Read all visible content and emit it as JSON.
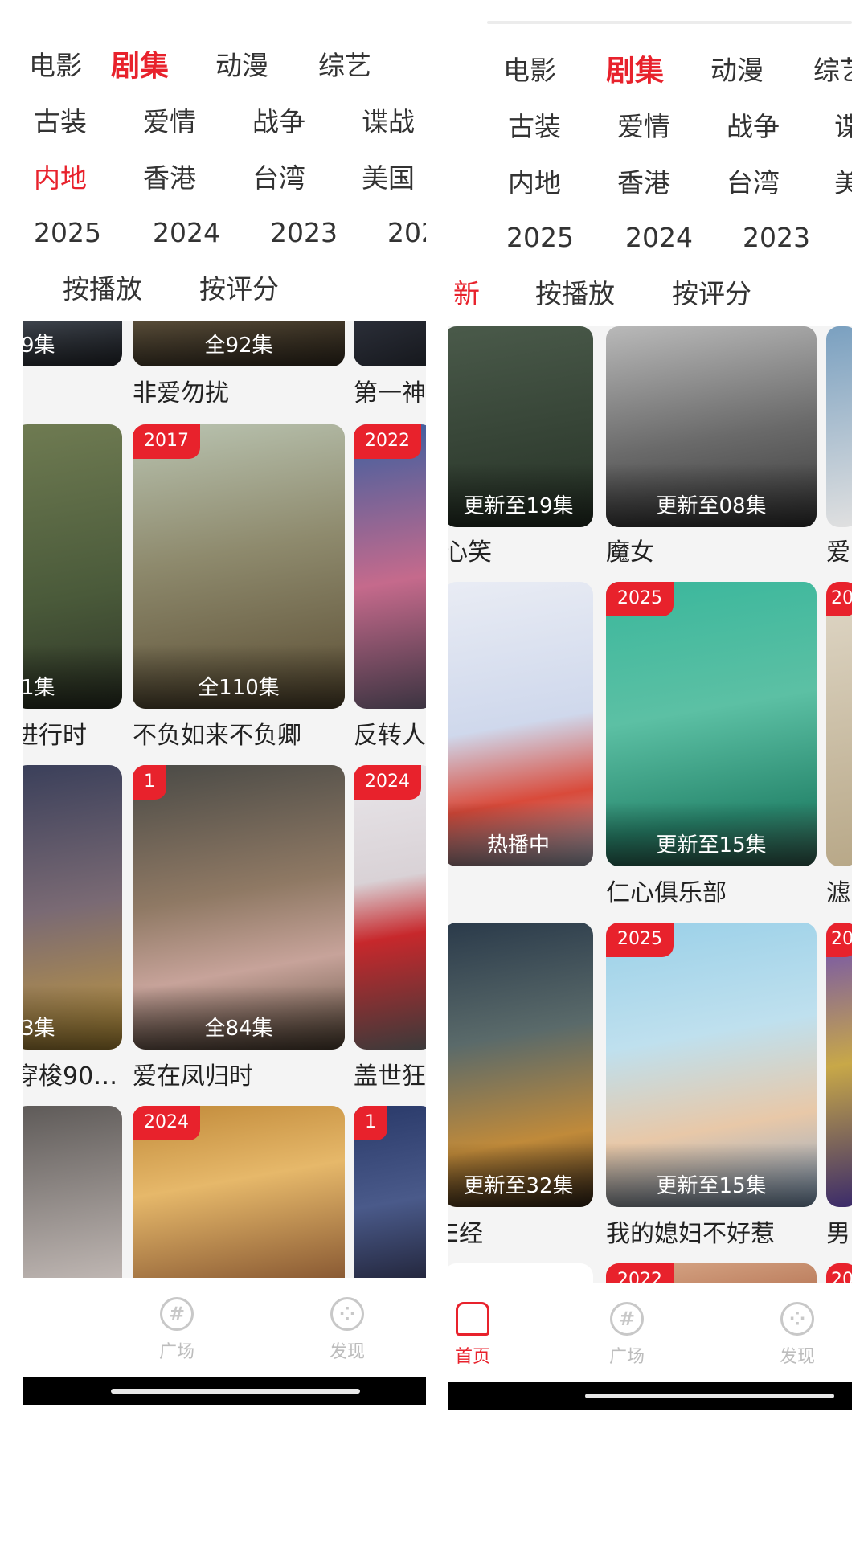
{
  "left": {
    "categories": [
      "电影",
      "剧集",
      "动漫",
      "综艺"
    ],
    "genres": [
      "古装",
      "爱情",
      "战争",
      "谍战"
    ],
    "regions": [
      "内地",
      "香港",
      "台湾",
      "美国"
    ],
    "years": [
      "2025",
      "2024",
      "2023",
      "202"
    ],
    "sorts": [
      "按播放",
      "按评分"
    ],
    "row0": [
      {
        "title": "",
        "ep": "9集"
      },
      {
        "title": "非爱勿扰",
        "ep": "全92集"
      },
      {
        "title": "第一神",
        "ep": ""
      }
    ],
    "row1": [
      {
        "title": "进行时",
        "ep": "1集",
        "badge": ""
      },
      {
        "title": "不负如来不负卿",
        "ep": "全110集",
        "badge": "2017"
      },
      {
        "title": "反转人",
        "ep": "",
        "badge": "2022"
      }
    ],
    "row2": [
      {
        "title": "穿梭90…",
        "ep": "3集",
        "badge": ""
      },
      {
        "title": "爱在凤归时",
        "ep": "全84集",
        "badge": "1"
      },
      {
        "title": "盖世狂",
        "ep": "",
        "badge": "2024"
      }
    ],
    "row3": [
      {
        "badge": ""
      },
      {
        "badge": "2024"
      },
      {
        "badge": "1"
      }
    ],
    "tabs": [
      "广场",
      "发现"
    ]
  },
  "right": {
    "categories": [
      "电影",
      "剧集",
      "动漫",
      "综艺"
    ],
    "genres": [
      "古装",
      "爱情",
      "战争",
      "谍"
    ],
    "regions": [
      "内地",
      "香港",
      "台湾",
      "美"
    ],
    "years": [
      "2025",
      "2024",
      "2023"
    ],
    "sorts": [
      "新",
      "按播放",
      "按评分"
    ],
    "row0": [
      {
        "title": "心笑",
        "ep": "更新至19集"
      },
      {
        "title": "魔女",
        "ep": "更新至08集"
      },
      {
        "title": "爱",
        "ep": ""
      }
    ],
    "row1": [
      {
        "title": "",
        "ep": "热播中",
        "badge": ""
      },
      {
        "title": "仁心俱乐部",
        "ep": "更新至15集",
        "badge": "2025"
      },
      {
        "title": "滤",
        "ep": "",
        "badge": "20"
      }
    ],
    "row2": [
      {
        "title": "E经",
        "ep": "更新至32集",
        "badge": ""
      },
      {
        "title": "我的媳妇不好惹",
        "ep": "更新至15集",
        "badge": "2025"
      },
      {
        "title": "男",
        "ep": "",
        "badge": "20"
      }
    ],
    "row3": [
      {
        "badge": ""
      },
      {
        "badge": "2022"
      },
      {
        "badge": "20"
      }
    ],
    "tabs": [
      "首页",
      "广场",
      "发现"
    ]
  },
  "colors": {
    "accent": "#e8222c"
  }
}
